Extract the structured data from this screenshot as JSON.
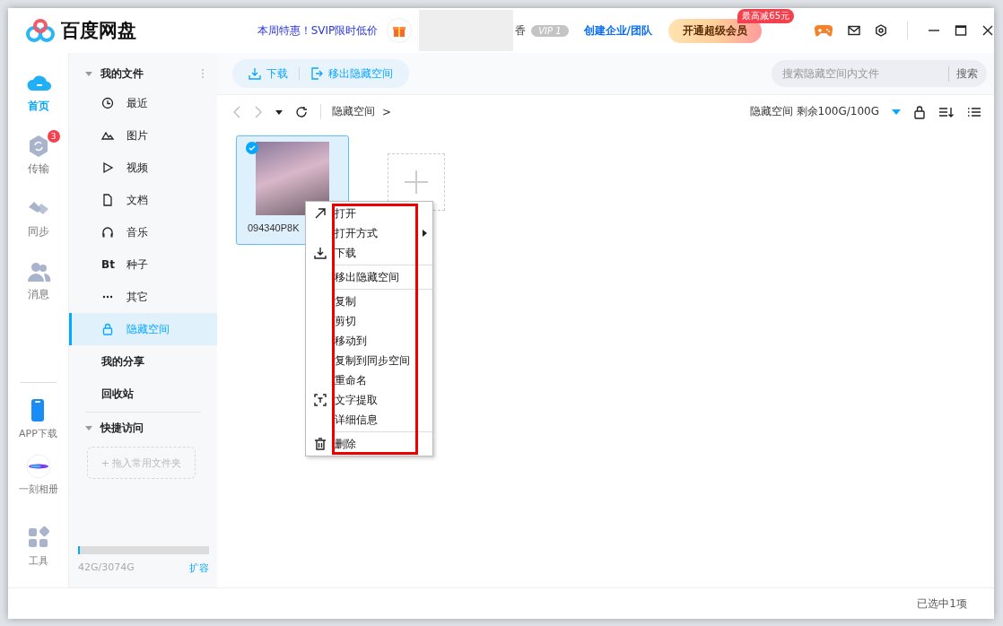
{
  "window": {
    "logo_text": "百度网盘"
  },
  "header": {
    "promo": "本周特惠！SVIP限时低价",
    "user_tail": "香",
    "vip_badge": "VIP 1",
    "enterprise_link": "创建企业/团队",
    "upgrade_button": "开通超级会员",
    "upgrade_badge": "最高减65元"
  },
  "left_nav": [
    {
      "label": "首页",
      "kind": "home",
      "selected": true
    },
    {
      "label": "传输",
      "kind": "transfer",
      "selected": false,
      "badge": "3"
    },
    {
      "label": "同步",
      "kind": "sync",
      "selected": false
    },
    {
      "label": "消息",
      "kind": "message",
      "selected": false
    }
  ],
  "left_nav_bottom": [
    {
      "label": "APP下载",
      "kind": "phone"
    },
    {
      "label": "一刻相册",
      "kind": "album"
    },
    {
      "label": "工具",
      "kind": "tools"
    }
  ],
  "sidebar": {
    "my_files": {
      "title": "我的文件",
      "expanded": true,
      "items": [
        {
          "label": "最近",
          "kind": "recent",
          "selected": false
        },
        {
          "label": "图片",
          "kind": "image",
          "selected": false
        },
        {
          "label": "视频",
          "kind": "video",
          "selected": false
        },
        {
          "label": "文档",
          "kind": "doc",
          "selected": false
        },
        {
          "label": "音乐",
          "kind": "music",
          "selected": false
        },
        {
          "label": "种子",
          "kind": "torrent",
          "icon_text": "Bt",
          "selected": false
        },
        {
          "label": "其它",
          "kind": "other",
          "selected": false
        },
        {
          "label": "隐藏空间",
          "kind": "lock",
          "selected": true
        }
      ]
    },
    "links": [
      {
        "label": "我的分享"
      },
      {
        "label": "回收站"
      }
    ],
    "quick_access": {
      "title": "快捷访问",
      "expanded": true,
      "dropzone": "+ 拖入常用文件夹"
    },
    "storage": {
      "level": 0.014,
      "usage": "42G/3074G",
      "expand_link": "扩容"
    }
  },
  "toolbar": {
    "actions": [
      {
        "label": "下载",
        "kind": "download"
      },
      {
        "label": "移出隐藏空间",
        "kind": "move-out"
      }
    ],
    "search": {
      "placeholder": "搜索隐藏空间内文件",
      "button": "搜索"
    }
  },
  "path_bar": {
    "breadcrumb": "隐藏空间",
    "breadcrumb_arrow": ">",
    "quota": "隐藏空间 剩余100G/100G"
  },
  "files": [
    {
      "kind": "image",
      "name": "094340P8K",
      "selected": true
    },
    {
      "kind": "add"
    }
  ],
  "context_menu": {
    "highlighted": true,
    "items": [
      {
        "label": "打开",
        "kind": "open",
        "has_submenu": false,
        "separator_after": false
      },
      {
        "label": "打开方式",
        "kind": "plain",
        "has_submenu": true,
        "separator_after": false
      },
      {
        "label": "下载",
        "kind": "download",
        "has_submenu": false,
        "separator_after": true
      },
      {
        "label": "移出隐藏空间",
        "kind": "plain",
        "has_submenu": false,
        "separator_after": true
      },
      {
        "label": "复制",
        "kind": "plain",
        "has_submenu": false,
        "separator_after": false
      },
      {
        "label": "剪切",
        "kind": "plain",
        "has_submenu": false,
        "separator_after": false
      },
      {
        "label": "移动到",
        "kind": "plain",
        "has_submenu": false,
        "separator_after": false
      },
      {
        "label": "复制到同步空间",
        "kind": "plain",
        "has_submenu": false,
        "separator_after": false
      },
      {
        "label": "重命名",
        "kind": "plain",
        "has_submenu": false,
        "separator_after": false
      },
      {
        "label": "文字提取",
        "kind": "text",
        "has_submenu": false,
        "separator_after": false
      },
      {
        "label": "详细信息",
        "kind": "plain",
        "has_submenu": false,
        "separator_after": true
      },
      {
        "label": "删除",
        "kind": "delete",
        "has_submenu": false,
        "separator_after": false
      }
    ]
  },
  "status_bar": {
    "text": "已选中1项"
  }
}
